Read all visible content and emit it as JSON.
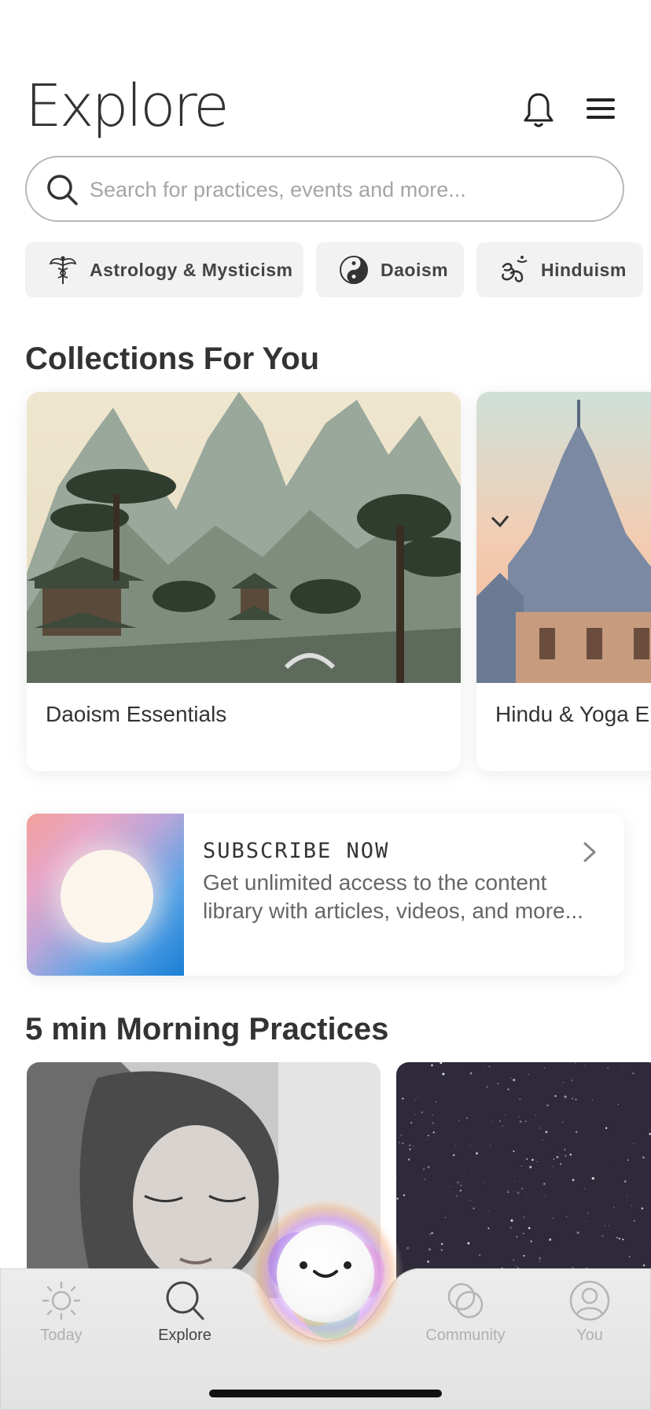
{
  "header": {
    "title": "Explore"
  },
  "search": {
    "placeholder": "Search for practices, events and more..."
  },
  "chips": [
    {
      "label": "Astrology & Mysticism",
      "icon": "caduceus-icon"
    },
    {
      "label": "Daoism",
      "icon": "yin-yang-icon"
    },
    {
      "label": "Hinduism",
      "icon": "om-icon"
    }
  ],
  "collections": {
    "heading": "Collections For You",
    "items": [
      {
        "label": "Daoism Essentials"
      },
      {
        "label": "Hindu & Yoga E"
      }
    ]
  },
  "subscribe": {
    "title": "SUBSCRIBE NOW",
    "text": "Get unlimited access to the content library with articles, videos, and more..."
  },
  "morning": {
    "heading": "5 min Morning Practices"
  },
  "tabs": [
    {
      "label": "Today",
      "icon": "sun-icon"
    },
    {
      "label": "Explore",
      "icon": "search-icon"
    },
    {
      "label": "Community",
      "icon": "community-icon"
    },
    {
      "label": "You",
      "icon": "profile-icon"
    }
  ],
  "colors": {
    "text": "#333333",
    "muted": "#b0b0b0",
    "chip_bg": "#f2f2f2"
  }
}
